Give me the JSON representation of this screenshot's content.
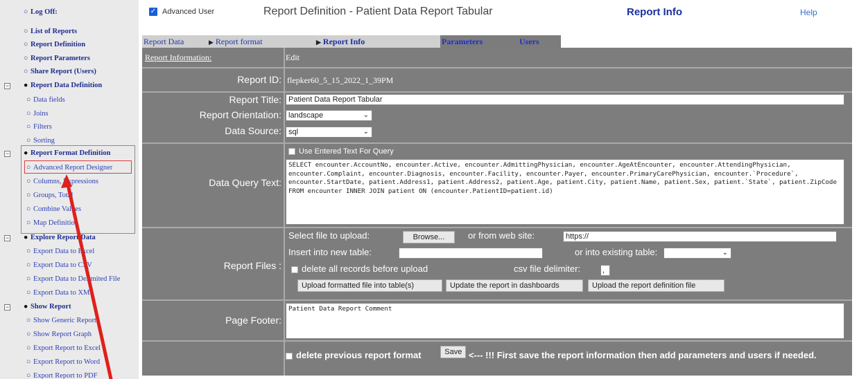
{
  "sidebar": {
    "items": [
      {
        "label": "Log Off:",
        "bold": true,
        "level": 1
      },
      {
        "label": "List of Reports",
        "bold": true,
        "level": 1
      },
      {
        "label": "Report Definition",
        "bold": true,
        "level": 1
      },
      {
        "label": "Report Parameters",
        "bold": true,
        "level": 1
      },
      {
        "label": "Share Report (Users)",
        "bold": true,
        "level": 1
      },
      {
        "label": "Report Data Definition",
        "bold": true,
        "level": 1
      },
      {
        "label": "Data fields",
        "level": 2
      },
      {
        "label": "Joins",
        "level": 2
      },
      {
        "label": "Filters",
        "level": 2
      },
      {
        "label": "Sorting",
        "level": 2
      },
      {
        "label": "Report Format Definition",
        "bold": true,
        "level": 1
      },
      {
        "label": "Advanced Report Designer",
        "level": 2
      },
      {
        "label": "Columns, Expressions",
        "level": 2
      },
      {
        "label": "Groups, Total",
        "level": 2
      },
      {
        "label": "Combine Values",
        "level": 2
      },
      {
        "label": "Map Definition",
        "level": 2
      },
      {
        "label": "Explore Report Data",
        "bold": true,
        "level": 1
      },
      {
        "label": "Export Data to Excel",
        "level": 2
      },
      {
        "label": "Export Data to CSV",
        "level": 2
      },
      {
        "label": "Export Data to Delimited File",
        "level": 2
      },
      {
        "label": "Export Data to XML",
        "level": 2
      },
      {
        "label": "Show Report",
        "bold": true,
        "level": 1
      },
      {
        "label": "Show Generic Report",
        "level": 2
      },
      {
        "label": "Show Report Graph",
        "level": 2
      },
      {
        "label": "Export Report to Excel",
        "level": 2
      },
      {
        "label": "Export Report to Word",
        "level": 2
      },
      {
        "label": "Export Report to PDF",
        "level": 2
      }
    ]
  },
  "header": {
    "advanced_user_label": "Advanced User",
    "advanced_user_checked": true,
    "title": "Report Definition - Patient Data Report Tabular",
    "section": "Report Info",
    "help": "Help"
  },
  "tabs": [
    {
      "label": "Report Data"
    },
    {
      "label": "Report format"
    },
    {
      "label": "Report Info",
      "active": true
    },
    {
      "label": "Parameters"
    },
    {
      "label": "Users"
    }
  ],
  "form": {
    "header_label": "Report Information:",
    "header_edit": "Edit",
    "report_id_label": "Report ID:",
    "report_id": "flepker60_5_15_2022_1_39PM",
    "report_title_label": "Report Title:",
    "report_title": "Patient Data Report Tabular",
    "orientation_label": "Report Orientation:",
    "orientation": "landscape",
    "data_source_label": "Data Source:",
    "data_source": "sql",
    "query_label": "Data Query Text:",
    "use_entered_text": "Use Entered Text For Query",
    "query_text": "SELECT encounter.AccountNo, encounter.Active, encounter.AdmittingPhysician, encounter.AgeAtEncounter, encounter.AttendingPhysician, encounter.Complaint, encounter.Diagnosis, encounter.Facility, encounter.Payer, encounter.PrimaryCarePhysician, encounter.`Procedure`, encounter.StartDate, patient.Address1, patient.Address2, patient.Age, patient.City, patient.Name, patient.Sex, patient.`State`, patient.ZipCode FROM encounter INNER JOIN patient ON (encounter.PatientID=patient.id)",
    "files_label": "Report Files :",
    "select_file": "Select file to upload:",
    "browse": "Browse...",
    "or_from_web": "or from web site:",
    "url_value": "https://",
    "insert_new_table": "Insert into new table:",
    "or_existing_table": "or into existing table:",
    "delete_records": "delete all records before upload",
    "csv_delimiter": "csv file delimiter:",
    "csv_delimiter_value": ",",
    "upload_formatted": "Upload formatted file into table(s)",
    "update_dashboards": "Update the report in dashboards",
    "upload_definition": "Upload the report definition file",
    "footer_label": "Page Footer:",
    "footer_text": "Patient Data Report Comment",
    "delete_previous": "delete previous report format",
    "save": "Save",
    "save_note": "<--- !!!  First save the report information then add parameters and users if needed."
  },
  "colors": {
    "panel": "#7d7d7d",
    "link": "#2d3fb5",
    "annotation": "#e0201c"
  }
}
